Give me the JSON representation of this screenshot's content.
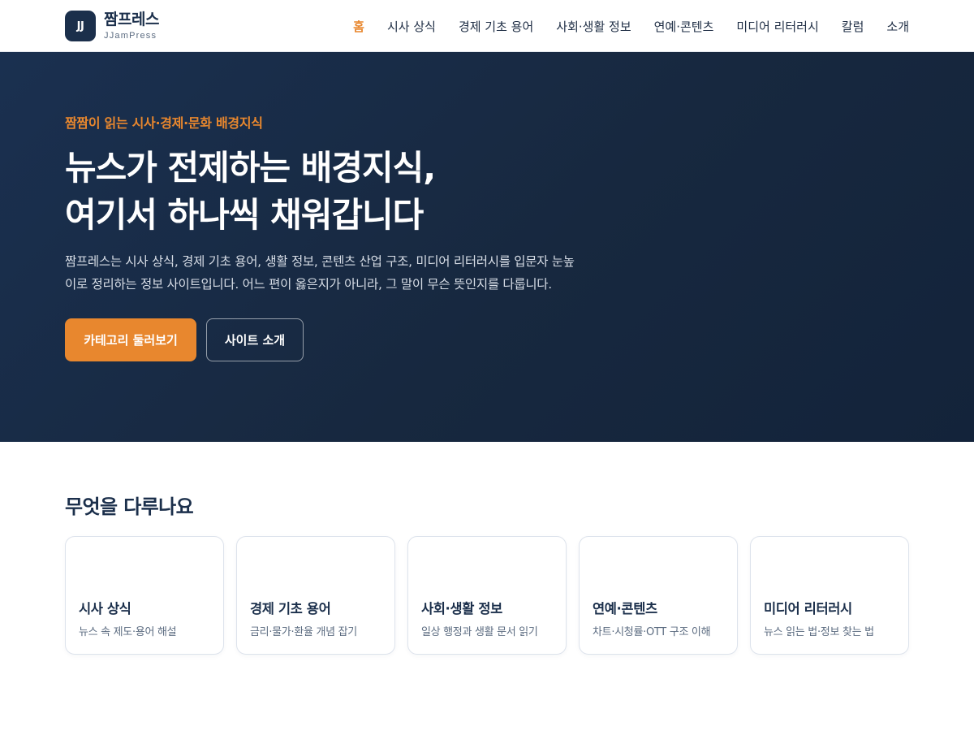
{
  "header": {
    "logo_mark": "JJ",
    "brand_name": "짬프레스",
    "brand_sub": "JJamPress",
    "nav": [
      {
        "label": "홈",
        "active": true
      },
      {
        "label": "시사 상식"
      },
      {
        "label": "경제 기초 용어"
      },
      {
        "label": "사회·생활 정보"
      },
      {
        "label": "연예·콘텐츠"
      },
      {
        "label": "미디어 리터러시"
      },
      {
        "label": "칼럼"
      },
      {
        "label": "소개"
      }
    ]
  },
  "hero": {
    "eyebrow": "짬짬이 읽는 시사·경제·문화 배경지식",
    "title_line1": "뉴스가 전제하는 배경지식,",
    "title_line2": "여기서 하나씩 채워갑니다",
    "description": "짬프레스는 시사 상식, 경제 기초 용어, 생활 정보, 콘텐츠 산업 구조, 미디어 리터러시를 입문자 눈높이로 정리하는 정보 사이트입니다. 어느 편이 옳은지가 아니라, 그 말이 무슨 뜻인지를 다룹니다.",
    "primary_button": "카테고리 둘러보기",
    "secondary_button": "사이트 소개"
  },
  "topics": {
    "title": "무엇을 다루나요",
    "cards": [
      {
        "title": "시사 상식",
        "desc": "뉴스 속 제도·용어 해설"
      },
      {
        "title": "경제 기초 용어",
        "desc": "금리·물가·환율 개념 잡기"
      },
      {
        "title": "사회·생활 정보",
        "desc": "일상 행정과 생활 문서 읽기"
      },
      {
        "title": "연예·콘텐츠",
        "desc": "차트·시청률·OTT 구조 이해"
      },
      {
        "title": "미디어 리터러시",
        "desc": "뉴스 읽는 법·정보 찾는 법"
      }
    ]
  },
  "colors": {
    "accent": "#e8872e",
    "navy": "#1b2f4b",
    "hero_bg": "#17283f"
  }
}
